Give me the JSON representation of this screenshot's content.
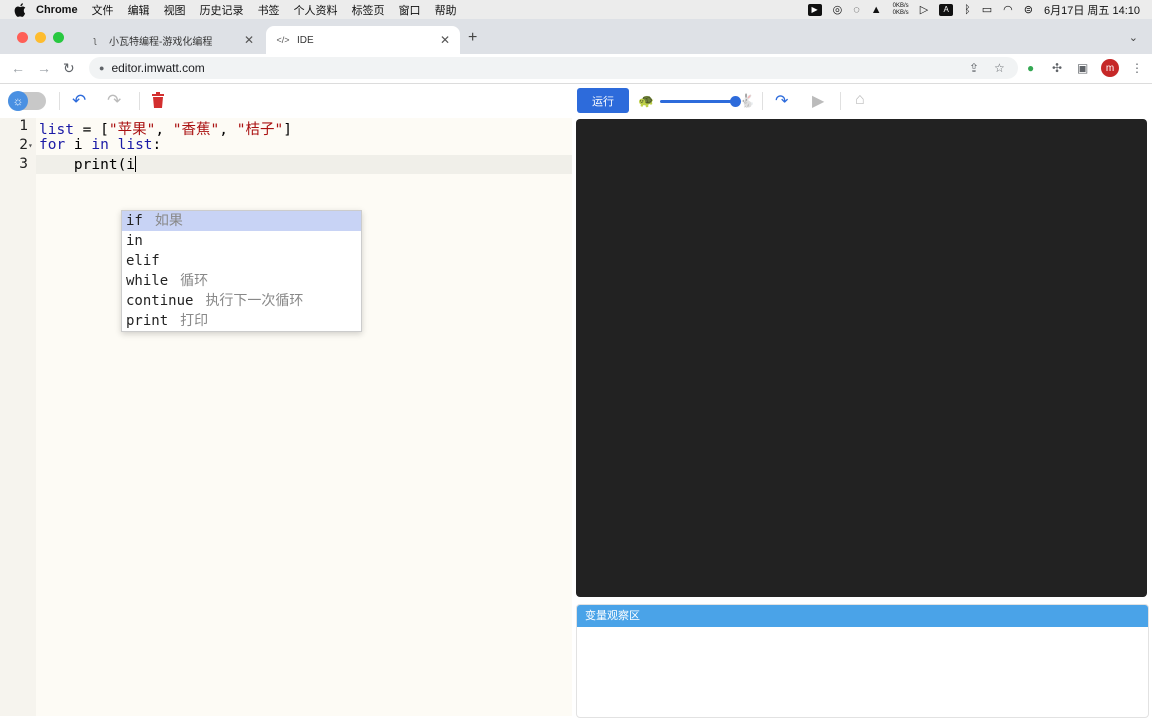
{
  "menubar": {
    "app_name": "Chrome",
    "items": [
      "文件",
      "编辑",
      "视图",
      "历史记录",
      "书签",
      "个人资料",
      "标签页",
      "窗口",
      "帮助"
    ],
    "net_up": "0KB/s",
    "net_down": "0KB/s",
    "clock": "6月17日 周五 14:10"
  },
  "tabs": [
    {
      "title": "小瓦特编程-游戏化编程",
      "active": false
    },
    {
      "title": "IDE",
      "active": true
    }
  ],
  "address": {
    "url": "editor.imwatt.com"
  },
  "profile": {
    "initial": "m"
  },
  "editor": {
    "line_numbers": [
      "1",
      "2",
      "3"
    ],
    "lines": [
      {
        "tokens": [
          {
            "text": "list",
            "cls": "kw"
          },
          {
            "text": " = [",
            "cls": ""
          },
          {
            "text": "\"苹果\"",
            "cls": "str"
          },
          {
            "text": ", ",
            "cls": ""
          },
          {
            "text": "\"香蕉\"",
            "cls": "str"
          },
          {
            "text": ", ",
            "cls": ""
          },
          {
            "text": "\"桔子\"",
            "cls": "str"
          },
          {
            "text": "]",
            "cls": ""
          }
        ]
      },
      {
        "tokens": [
          {
            "text": "for",
            "cls": "kw"
          },
          {
            "text": " i ",
            "cls": ""
          },
          {
            "text": "in",
            "cls": "kw"
          },
          {
            "text": " ",
            "cls": ""
          },
          {
            "text": "list",
            "cls": "kw"
          },
          {
            "text": ":",
            "cls": ""
          }
        ]
      },
      {
        "tokens": [
          {
            "text": "    print(i",
            "cls": ""
          }
        ]
      }
    ]
  },
  "autocomplete": [
    {
      "keyword": "if",
      "hint": "如果",
      "selected": true
    },
    {
      "keyword": "in",
      "hint": "",
      "selected": false
    },
    {
      "keyword": "elif",
      "hint": "",
      "selected": false
    },
    {
      "keyword": "while",
      "hint": "循环",
      "selected": false
    },
    {
      "keyword": "continue",
      "hint": "执行下一次循环",
      "selected": false
    },
    {
      "keyword": "print",
      "hint": "打印",
      "selected": false
    }
  ],
  "run_panel": {
    "run_label": "运行",
    "speed_level": 1.0,
    "watch_title": "变量观察区"
  },
  "colors": {
    "run_button": "#2d6bdb",
    "watch_header": "#4aa3e8",
    "canvas": "#222222",
    "delete_icon": "#d32f2f"
  }
}
